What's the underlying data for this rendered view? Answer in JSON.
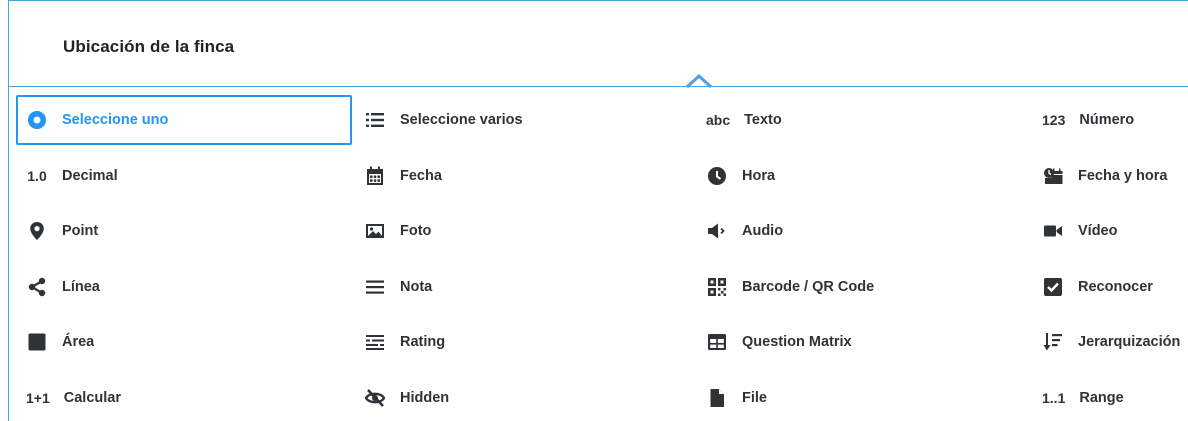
{
  "header": {
    "title": "Ubicación de la finca"
  },
  "colors": {
    "accent": "#2196f3",
    "border": "#4aa3df",
    "text": "#2f3338"
  },
  "types": [
    [
      {
        "label": "Seleccione uno",
        "icon": "radio-icon",
        "selected": true
      },
      {
        "label": "Seleccione varios",
        "icon": "list-icon"
      },
      {
        "label": "Texto",
        "icon": "abc-icon",
        "icon_text": "abc"
      },
      {
        "label": "Número",
        "icon": "number-icon",
        "icon_text": "123"
      }
    ],
    [
      {
        "label": "Decimal",
        "icon": "decimal-icon",
        "icon_text": "1.0"
      },
      {
        "label": "Fecha",
        "icon": "calendar-icon"
      },
      {
        "label": "Hora",
        "icon": "clock-icon"
      },
      {
        "label": "Fecha y hora",
        "icon": "datetime-icon"
      }
    ],
    [
      {
        "label": "Point",
        "icon": "map-pin-icon"
      },
      {
        "label": "Foto",
        "icon": "photo-icon"
      },
      {
        "label": "Audio",
        "icon": "volume-icon"
      },
      {
        "label": "Vídeo",
        "icon": "video-icon"
      }
    ],
    [
      {
        "label": "Línea",
        "icon": "share-icon"
      },
      {
        "label": "Nota",
        "icon": "note-icon"
      },
      {
        "label": "Barcode / QR Code",
        "icon": "qr-code-icon"
      },
      {
        "label": "Reconocer",
        "icon": "checkbox-icon"
      }
    ],
    [
      {
        "label": "Área",
        "icon": "square-icon"
      },
      {
        "label": "Rating",
        "icon": "rating-icon"
      },
      {
        "label": "Question Matrix",
        "icon": "table-icon"
      },
      {
        "label": "Jerarquización",
        "icon": "sort-icon"
      }
    ],
    [
      {
        "label": "Calcular",
        "icon": "calculate-icon",
        "icon_text": "1+1"
      },
      {
        "label": "Hidden",
        "icon": "eye-slash-icon"
      },
      {
        "label": "File",
        "icon": "file-icon"
      },
      {
        "label": "Range",
        "icon": "range-icon",
        "icon_text": "1..1"
      }
    ]
  ]
}
